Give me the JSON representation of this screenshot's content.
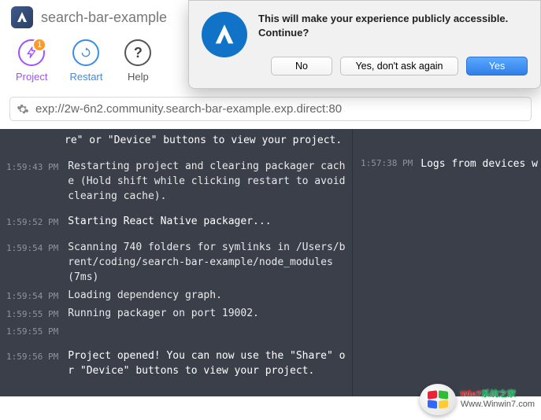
{
  "header": {
    "title": "search-bar-example"
  },
  "toolbar": {
    "project": {
      "label": "Project",
      "badge": "1"
    },
    "restart": {
      "label": "Restart"
    },
    "help": {
      "label": "Help"
    }
  },
  "urlbar": {
    "value": "exp://2w-6n2.community.search-bar-example.exp.direct:80"
  },
  "modal": {
    "line1": "This will make your experience publicly accessible.",
    "line2": "Continue?",
    "no": "No",
    "dont": "Yes, don't ask again",
    "yes": "Yes"
  },
  "logs_left": [
    {
      "time": "",
      "msg": "re\" or \"Device\" buttons to view your project.",
      "bright": true
    },
    {
      "time": "1:59:43 PM",
      "msg": "Restarting project and clearing packager cache (Hold shift while clicking restart to avoid clearing cache).",
      "spaced": true
    },
    {
      "time": "1:59:52 PM",
      "msg": "Starting React Native packager...",
      "bright": true,
      "spaced": true
    },
    {
      "time": "1:59:54 PM",
      "msg": "Scanning 740 folders for symlinks in /Users/brent/coding/search-bar-example/node_modules (7ms)",
      "spaced": true
    },
    {
      "time": "1:59:54 PM",
      "msg": "Loading dependency graph."
    },
    {
      "time": "1:59:55 PM",
      "msg": "Running packager on port 19002."
    },
    {
      "time": "1:59:55 PM",
      "msg": ""
    },
    {
      "time": "1:59:56 PM",
      "msg": "Project opened! You can now use the \"Share\" or \"Device\" buttons to view your project.",
      "bright": true,
      "spaced": true
    }
  ],
  "logs_right": [
    {
      "time": "1:57:38 PM",
      "msg": "Logs from devices w"
    }
  ],
  "watermark": {
    "line1a": "Win7",
    "line1b": "系统之家",
    "line2": "Www.Winwin7.com"
  }
}
